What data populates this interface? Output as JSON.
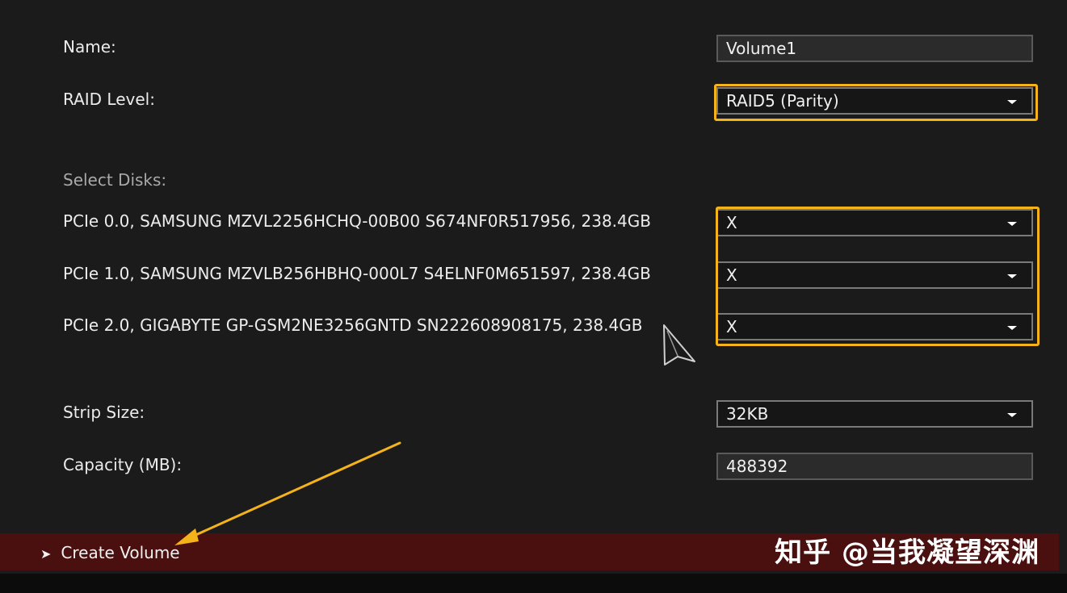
{
  "form": {
    "name_label": "Name:",
    "name_value": "Volume1",
    "raid_label": "RAID Level:",
    "raid_value": "RAID5 (Parity)",
    "select_disks_label": "Select Disks:",
    "disks": [
      {
        "label": "PCIe 0.0, SAMSUNG MZVL2256HCHQ-00B00 S674NF0R517956, 238.4GB",
        "value": "X"
      },
      {
        "label": "PCIe 1.0, SAMSUNG MZVLB256HBHQ-000L7 S4ELNF0M651597, 238.4GB",
        "value": "X"
      },
      {
        "label": "PCIe 2.0, GIGABYTE GP-GSM2NE3256GNTD SN222608908175, 238.4GB",
        "value": "X"
      }
    ],
    "strip_label": "Strip Size:",
    "strip_value": "32KB",
    "capacity_label": "Capacity (MB):",
    "capacity_value": "488392"
  },
  "footer": {
    "create_label": "Create Volume",
    "chevron_glyph": "➤",
    "watermark": "知乎 @当我凝望深渊"
  },
  "colors": {
    "highlight": "#f4b31a",
    "footer_bar": "#4a0f0f",
    "background": "#1b1b1b"
  }
}
